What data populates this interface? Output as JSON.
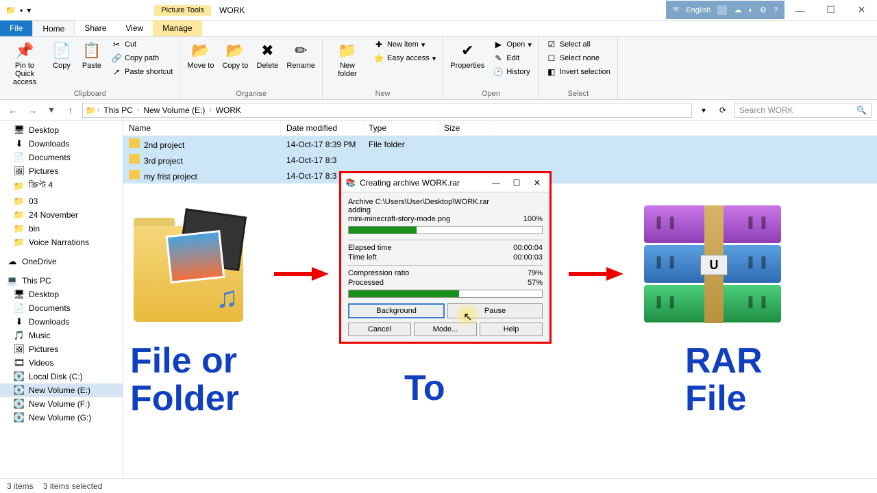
{
  "titlebar": {
    "tools_tab": "Picture Tools",
    "title": "WORK",
    "lang": "English"
  },
  "tabs": {
    "file": "File",
    "home": "Home",
    "share": "Share",
    "view": "View",
    "manage": "Manage"
  },
  "ribbon": {
    "clipboard": {
      "label": "Clipboard",
      "pin": "Pin to Quick access",
      "copy": "Copy",
      "paste": "Paste",
      "cut": "Cut",
      "copy_path": "Copy path",
      "paste_shortcut": "Paste shortcut"
    },
    "organise": {
      "label": "Organise",
      "move": "Move to",
      "copy": "Copy to",
      "delete": "Delete",
      "rename": "Rename"
    },
    "new": {
      "label": "New",
      "folder": "New folder",
      "item": "New item",
      "easy": "Easy access"
    },
    "open": {
      "label": "Open",
      "properties": "Properties",
      "open": "Open",
      "edit": "Edit",
      "history": "History"
    },
    "select": {
      "label": "Select",
      "all": "Select all",
      "none": "Select none",
      "invert": "Invert selection"
    }
  },
  "breadcrumb": {
    "root": "This PC",
    "vol": "New Volume (E:)",
    "folder": "WORK"
  },
  "search_placeholder": "Search WORK",
  "columns": {
    "name": "Name",
    "date": "Date modified",
    "type": "Type",
    "size": "Size"
  },
  "rows": [
    {
      "name": "2nd project",
      "date": "14-Oct-17 8:39 PM",
      "type": "File folder"
    },
    {
      "name": "3rd project",
      "date": "14-Oct-17 8:3",
      "type": ""
    },
    {
      "name": "my frist project",
      "date": "14-Oct-17 8:3",
      "type": ""
    }
  ],
  "sidebar": {
    "group1": [
      "Desktop",
      "Downloads",
      "Documents",
      "Pictures",
      "স্ক্রিপ্ট 4",
      "03",
      "24 November",
      "bin",
      "Voice Narrations"
    ],
    "onedrive": "OneDrive",
    "thispc": "This PC",
    "group2": [
      "Desktop",
      "Documents",
      "Downloads",
      "Music",
      "Pictures",
      "Videos",
      "Local Disk (C:)",
      "New Volume (E:)",
      "New Volume (F:)",
      "New Volume (G:)"
    ]
  },
  "status": {
    "items": "3 items",
    "selected": "3 items selected"
  },
  "dialog": {
    "title": "Creating archive WORK.rar",
    "path": "Archive C:\\Users\\User\\Desktop\\WORK.rar",
    "adding": "adding",
    "file": "mini-minecraft-story-mode.png",
    "file_pct": "100%",
    "elapsed_lbl": "Elapsed time",
    "elapsed": "00:00:04",
    "left_lbl": "Time left",
    "left": "00:00:03",
    "ratio_lbl": "Compression ratio",
    "ratio": "79%",
    "proc_lbl": "Processed",
    "proc": "57%",
    "background": "Background",
    "pause": "Pause",
    "cancel": "Cancel",
    "mode": "Mode...",
    "help": "Help"
  },
  "captions": {
    "left": "File or Folder",
    "mid": "To",
    "right": "RAR File"
  }
}
